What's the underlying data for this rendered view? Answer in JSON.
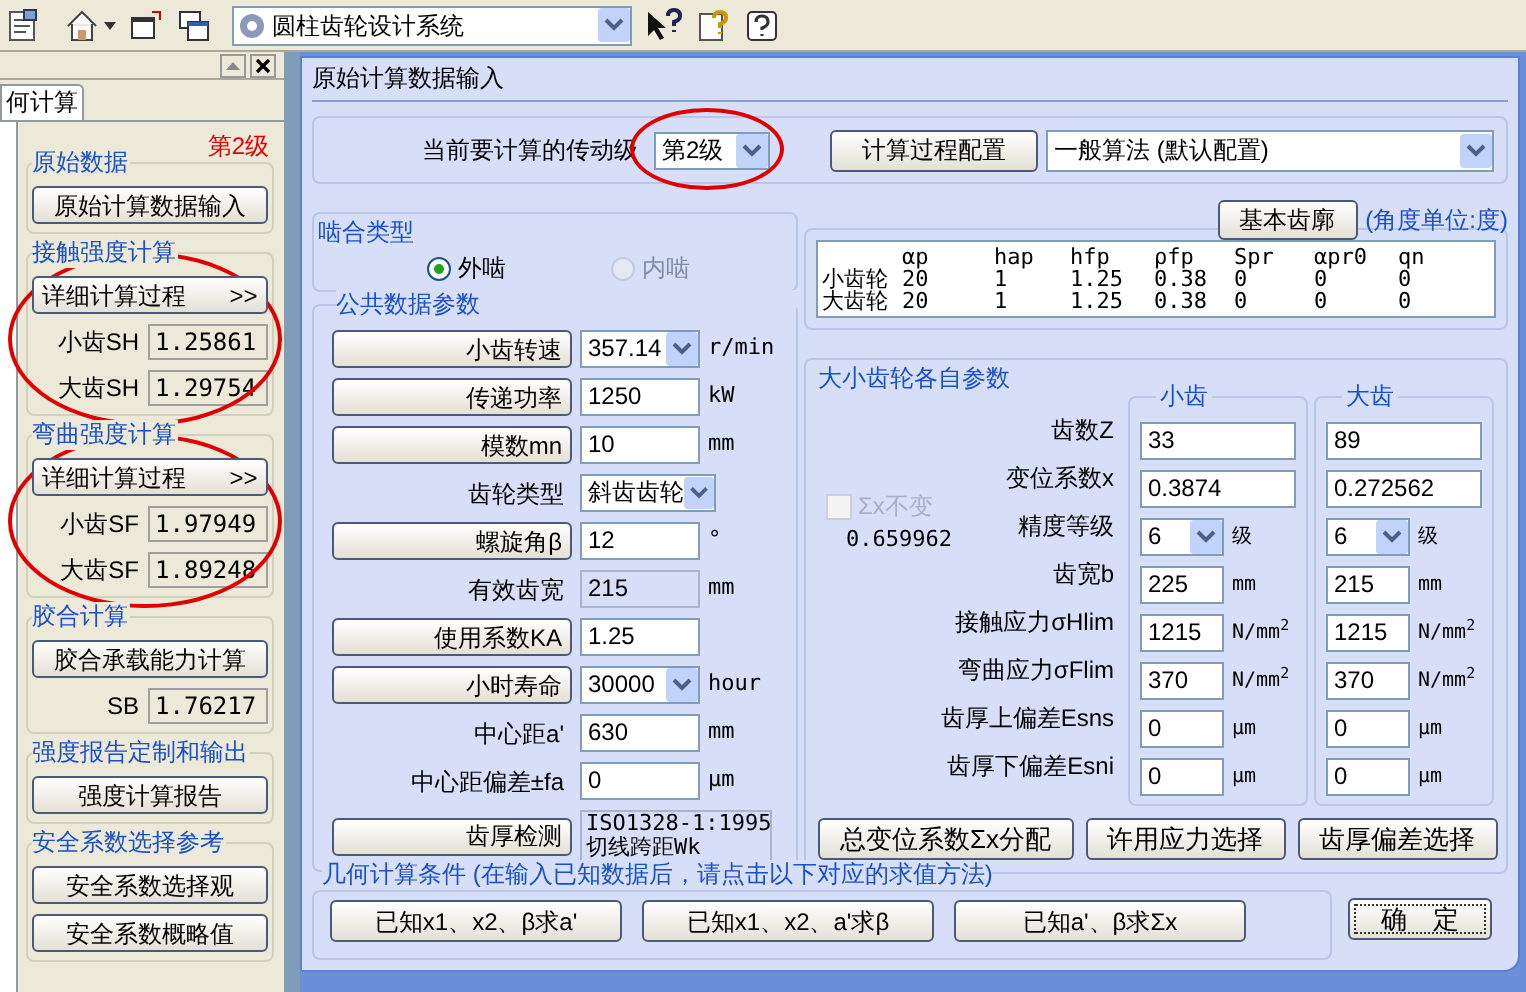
{
  "toolbar": {
    "app_select": "圆柱齿轮设计系统"
  },
  "left_panel": {
    "tab": "何计算",
    "stage_badge": "第2级",
    "groups": [
      {
        "title": "原始数据",
        "items": [
          {
            "kind": "button",
            "label": "原始计算数据输入"
          }
        ]
      },
      {
        "title": "接触强度计算",
        "circled": true,
        "items": [
          {
            "kind": "button",
            "label": "详细计算过程",
            "arrow": ">>"
          },
          {
            "kind": "value",
            "label": "小齿SH",
            "value": "1.25861"
          },
          {
            "kind": "value",
            "label": "大齿SH",
            "value": "1.29754"
          }
        ]
      },
      {
        "title": "弯曲强度计算",
        "circled": true,
        "items": [
          {
            "kind": "button",
            "label": "详细计算过程",
            "arrow": ">>"
          },
          {
            "kind": "value",
            "label": "小齿SF",
            "value": "1.97949"
          },
          {
            "kind": "value",
            "label": "大齿SF",
            "value": "1.89248"
          }
        ]
      },
      {
        "title": "胶合计算",
        "items": [
          {
            "kind": "button",
            "label": "胶合承载能力计算"
          },
          {
            "kind": "value",
            "label": "SB",
            "value": "1.76217"
          }
        ]
      },
      {
        "title": "强度报告定制和输出",
        "items": [
          {
            "kind": "button",
            "label": "强度计算报告"
          }
        ]
      },
      {
        "title": "安全系数选择参考",
        "items": [
          {
            "kind": "button",
            "label": "安全系数选择观"
          },
          {
            "kind": "button",
            "label": "安全系数概略值"
          }
        ]
      }
    ]
  },
  "dialog": {
    "title": "原始计算数据输入",
    "stage_label": "当前要计算的传动级",
    "stage_select": {
      "value": "第2级",
      "circled": true
    },
    "config_button": "计算过程配置",
    "algorithm_select": "一般算法 (默认配置)",
    "mesh": {
      "title": "啮合类型",
      "options": [
        {
          "label": "外啮",
          "selected": true,
          "disabled": false
        },
        {
          "label": "内啮",
          "selected": false,
          "disabled": true
        }
      ]
    },
    "common": {
      "title": "公共数据参数",
      "rows": [
        {
          "kind": "button",
          "label": "小齿转速",
          "field": {
            "kind": "select",
            "value": "357.14"
          },
          "unit": "r/min"
        },
        {
          "kind": "button",
          "label": "传递功率",
          "field": {
            "kind": "input",
            "value": "1250"
          },
          "unit": "kW"
        },
        {
          "kind": "button",
          "label": "模数mn",
          "field": {
            "kind": "input",
            "value": "10"
          },
          "unit": "mm"
        },
        {
          "kind": "text",
          "label": "齿轮类型",
          "field": {
            "kind": "select",
            "value": "斜齿齿轮"
          }
        },
        {
          "kind": "button",
          "label": "螺旋角β",
          "field": {
            "kind": "input",
            "value": "12"
          },
          "unit": "°"
        },
        {
          "kind": "text",
          "label": "有效齿宽",
          "field": {
            "kind": "readonly",
            "value": "215"
          },
          "unit": "mm"
        },
        {
          "kind": "button",
          "label": "使用系数KA",
          "field": {
            "kind": "input",
            "value": "1.25"
          }
        },
        {
          "kind": "button",
          "label": "小时寿命",
          "field": {
            "kind": "select",
            "value": "30000"
          },
          "unit": "hour"
        },
        {
          "kind": "text",
          "label": "中心距a'",
          "field": {
            "kind": "input",
            "value": "630"
          },
          "unit": "mm"
        },
        {
          "kind": "text",
          "label": "中心距偏差±fa",
          "field": {
            "kind": "input",
            "value": "0"
          },
          "unit": "μm"
        },
        {
          "kind": "button",
          "label": "齿厚检测",
          "field": {
            "kind": "note",
            "lines": [
              "ISO1328-1:1995",
              "切线跨距Wk"
            ]
          }
        }
      ]
    },
    "profile": {
      "button": "基本齿廓",
      "note": "(角度单位:度)",
      "columns": [
        "αp",
        "hap",
        "hfp",
        "ρfp",
        "Spr",
        "αpr0",
        "qn"
      ],
      "rows": [
        {
          "name": "小齿轮",
          "values": [
            "20",
            "1",
            "1.25",
            "0.38",
            "0",
            "0",
            "0"
          ]
        },
        {
          "name": "大齿轮",
          "values": [
            "20",
            "1",
            "1.25",
            "0.38",
            "0",
            "0",
            "0"
          ]
        }
      ]
    },
    "gears": {
      "title": "大小齿轮各自参数",
      "columns": [
        "小齿",
        "大齿"
      ],
      "sum_check": {
        "label": "Σx不变",
        "checked": false,
        "disabled": true,
        "value": "0.659962"
      },
      "rows": [
        {
          "label": "齿数Z",
          "cells": [
            {
              "kind": "input",
              "value": "33"
            },
            {
              "kind": "input",
              "value": "89"
            }
          ]
        },
        {
          "label": "变位系数x",
          "cells": [
            {
              "kind": "input",
              "value": "0.3874"
            },
            {
              "kind": "input",
              "value": "0.272562"
            }
          ]
        },
        {
          "label": "精度等级",
          "cells": [
            {
              "kind": "select",
              "value": "6",
              "unit": "级"
            },
            {
              "kind": "select",
              "value": "6",
              "unit": "级"
            }
          ]
        },
        {
          "label": "齿宽b",
          "cells": [
            {
              "kind": "input",
              "value": "225",
              "unit": "mm"
            },
            {
              "kind": "input",
              "value": "215",
              "unit": "mm"
            }
          ]
        },
        {
          "label": "接触应力σHlim",
          "cells": [
            {
              "kind": "input",
              "value": "1215",
              "unit": "N/mm$^{2}$"
            },
            {
              "kind": "input",
              "value": "1215",
              "unit": "N/mm$^{2}$"
            }
          ]
        },
        {
          "label": "弯曲应力σFlim",
          "cells": [
            {
              "kind": "input",
              "value": "370",
              "unit": "N/mm$^{2}$"
            },
            {
              "kind": "input",
              "value": "370",
              "unit": "N/mm$^{2}$"
            }
          ]
        },
        {
          "label": "齿厚上偏差Esns",
          "cells": [
            {
              "kind": "input",
              "value": "0",
              "unit": "μm"
            },
            {
              "kind": "input",
              "value": "0",
              "unit": "μm"
            }
          ]
        },
        {
          "label": "齿厚下偏差Esni",
          "cells": [
            {
              "kind": "input",
              "value": "0",
              "unit": "μm"
            },
            {
              "kind": "input",
              "value": "0",
              "unit": "μm"
            }
          ]
        }
      ],
      "buttons": [
        "总变位系数Σx分配",
        "许用应力选择",
        "齿厚偏差选择"
      ]
    },
    "geometry": {
      "title": "几何计算条件 (在输入已知数据后，请点击以下对应的求值方法)",
      "buttons": [
        "已知x1、x2、β求a'",
        "已知x1、x2、a'求β",
        "已知a'、β求Σx"
      ]
    },
    "ok_button": "确　定"
  }
}
